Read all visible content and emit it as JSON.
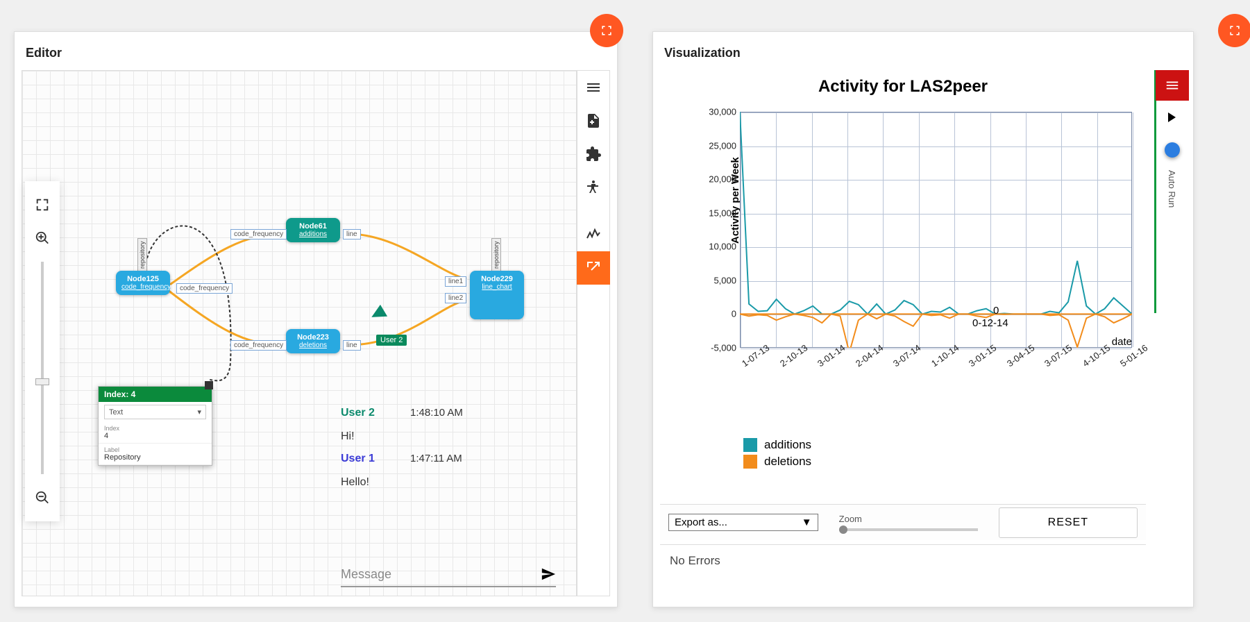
{
  "panels": {
    "editor_title": "Editor",
    "visualization_title": "Visualization"
  },
  "editor": {
    "nodes": {
      "n125": {
        "id": "Node125",
        "sub": "code_frequency"
      },
      "n61": {
        "id": "Node61",
        "sub": "additions"
      },
      "n223": {
        "id": "Node223",
        "sub": "deletions"
      },
      "n229": {
        "id": "Node229",
        "sub": "line_chart"
      }
    },
    "port_labels": {
      "cf1": "code_frequency",
      "cf2": "code_frequency",
      "cf3": "code_frequency",
      "line_a": "line",
      "line_b": "line",
      "line1": "line1",
      "line2": "line2"
    },
    "tags": {
      "repo1": "repository",
      "repo2": "repository",
      "user2": "User 2"
    },
    "right_toolbar": {
      "menu": "menu-icon",
      "new_file": "new-file-icon",
      "plugin": "puzzle-icon",
      "accessibility": "accessibility-icon",
      "activity": "activity-icon",
      "export": "export-icon"
    },
    "zoom_toolbar": {
      "fullscreen": "fullscreen-icon",
      "zoom_in": "zoom-in-icon",
      "zoom_out": "zoom-out-icon"
    },
    "property_panel": {
      "header": "Index: 4",
      "type_selected": "Text",
      "fields": [
        {
          "label": "Index",
          "value": "4"
        },
        {
          "label": "Label",
          "value": "Repository"
        }
      ]
    },
    "chat": {
      "messages": [
        {
          "user": "User 2",
          "ts": "1:48:10 AM",
          "body": "Hi!"
        },
        {
          "user": "User 1",
          "ts": "1:47:11 AM",
          "body": "Hello!"
        }
      ],
      "input_placeholder": "Message"
    }
  },
  "visualization": {
    "sidebar": {
      "auto_run": "Auto Run"
    },
    "export_selected": "Export as...",
    "zoom_label": "Zoom",
    "reset_label": "RESET",
    "status": "No Errors",
    "hover": {
      "val": "0",
      "date": "0-12-14"
    }
  },
  "colors": {
    "additions": "#1a9aa8",
    "deletions": "#f28c1b",
    "accent_orange": "#ff5722",
    "node_blue": "#29a9e0",
    "menu_red": "#cc1212"
  },
  "chart_data": {
    "type": "line",
    "title": "Activity for LAS2peer",
    "xlabel": "date",
    "ylabel": "Activity per Week",
    "ylim": [
      -5000,
      30000
    ],
    "y_ticks": [
      -5000,
      0,
      5000,
      10000,
      15000,
      20000,
      25000,
      30000
    ],
    "x_ticks": [
      "1-07-13",
      "2-10-13",
      "3-01-14",
      "2-04-14",
      "3-07-14",
      "1-10-14",
      "3-01-15",
      "3-04-15",
      "3-07-15",
      "4-10-15",
      "5-01-16"
    ],
    "legend": [
      "additions",
      "deletions"
    ],
    "series": [
      {
        "name": "additions",
        "color": "#1a9aa8",
        "values": [
          30000,
          1500,
          400,
          500,
          2200,
          800,
          0,
          500,
          1200,
          0,
          0,
          600,
          1900,
          1400,
          0,
          1500,
          0,
          600,
          2000,
          1400,
          0,
          400,
          300,
          1000,
          0,
          0,
          500,
          800,
          0,
          100,
          0,
          0,
          0,
          0,
          400,
          200,
          1800,
          7900,
          1200,
          0,
          800,
          2400,
          1200,
          0
        ]
      },
      {
        "name": "deletions",
        "color": "#f28c1b",
        "values": [
          0,
          -300,
          -100,
          -200,
          -900,
          -400,
          0,
          -200,
          -500,
          -1300,
          0,
          -300,
          -5700,
          -900,
          0,
          -700,
          0,
          -300,
          -1100,
          -1800,
          0,
          -200,
          -100,
          -600,
          0,
          0,
          -300,
          -500,
          0,
          -50,
          0,
          0,
          0,
          0,
          -200,
          -100,
          -900,
          -4900,
          -600,
          0,
          -400,
          -1300,
          -700,
          0
        ]
      }
    ]
  }
}
